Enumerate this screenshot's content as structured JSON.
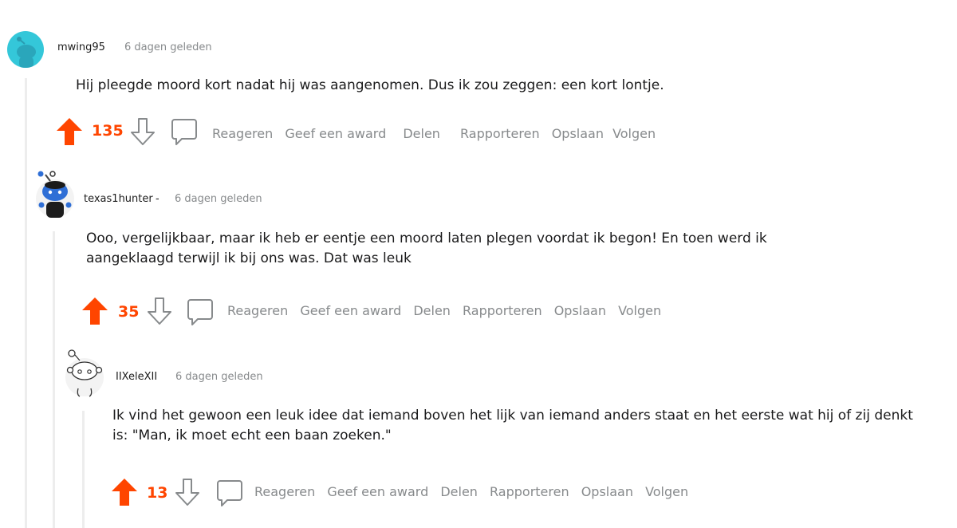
{
  "comments": [
    {
      "username": "mwing95",
      "time": "6 dagen geleden",
      "body": "Hij pleegde moord kort nadat hij was aangenomen. Dus ik zou zeggen: een kort lontje.",
      "score": "135",
      "actions": [
        "Reageren",
        "Geef een award",
        "Delen",
        "Rapporteren",
        "Opslaan",
        "Volgen"
      ]
    },
    {
      "username": "texas1hunter",
      "flair_sep": "-",
      "time": "6 dagen geleden",
      "body": "Ooo, vergelijkbaar, maar ik heb er eentje een moord laten plegen voordat ik begon! En toen werd ik aangeklaagd terwijl ik bij ons was. Dat was leuk",
      "score": "35",
      "actions": [
        "Reageren",
        "Geef een award",
        "Delen",
        "Rapporteren",
        "Opslaan",
        "Volgen"
      ]
    },
    {
      "username": "IIXeleXII",
      "time": "6 dagen geleden",
      "body": "Ik vind het gewoon een leuk idee dat iemand boven het lijk van iemand anders staat en het eerste wat hij of zij denkt is: \"Man, ik moet echt een baan zoeken.\"",
      "score": "13",
      "actions": [
        "Reageren",
        "Geef een award",
        "Delen",
        "Rapporteren",
        "Opslaan",
        "Volgen"
      ]
    }
  ],
  "colors": {
    "upvote": "#ff4500",
    "muted": "#878a8c",
    "thread": "#ededed"
  }
}
